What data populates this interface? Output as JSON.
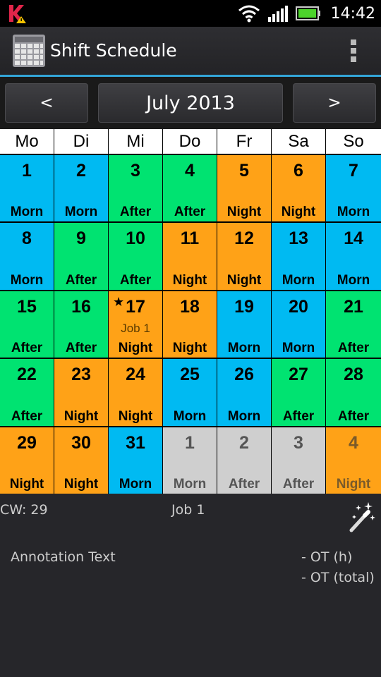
{
  "status_bar": {
    "time": "14:42",
    "left_icon": "k-notification-icon",
    "icons": [
      "wifi-icon",
      "signal-icon",
      "battery-icon"
    ]
  },
  "app": {
    "title": "Shift Schedule"
  },
  "nav": {
    "prev_label": "<",
    "month_label": "July 2013",
    "next_label": ">"
  },
  "weekdays": [
    "Mo",
    "Di",
    "Mi",
    "Do",
    "Fr",
    "Sa",
    "So"
  ],
  "colors": {
    "Morn": "#00baf2",
    "After": "#00e371",
    "Night": "#ffa217",
    "other_month": "#cfcfcf",
    "accent": "#33a6d8"
  },
  "calendar": [
    {
      "day": "1",
      "shift": "Morn"
    },
    {
      "day": "2",
      "shift": "Morn"
    },
    {
      "day": "3",
      "shift": "After"
    },
    {
      "day": "4",
      "shift": "After"
    },
    {
      "day": "5",
      "shift": "Night"
    },
    {
      "day": "6",
      "shift": "Night"
    },
    {
      "day": "7",
      "shift": "Morn"
    },
    {
      "day": "8",
      "shift": "Morn"
    },
    {
      "day": "9",
      "shift": "After"
    },
    {
      "day": "10",
      "shift": "After"
    },
    {
      "day": "11",
      "shift": "Night"
    },
    {
      "day": "12",
      "shift": "Night"
    },
    {
      "day": "13",
      "shift": "Morn"
    },
    {
      "day": "14",
      "shift": "Morn"
    },
    {
      "day": "15",
      "shift": "After"
    },
    {
      "day": "16",
      "shift": "After"
    },
    {
      "day": "17",
      "shift": "Night",
      "job": "Job 1",
      "star": true
    },
    {
      "day": "18",
      "shift": "Night"
    },
    {
      "day": "19",
      "shift": "Morn"
    },
    {
      "day": "20",
      "shift": "Morn"
    },
    {
      "day": "21",
      "shift": "After"
    },
    {
      "day": "22",
      "shift": "After"
    },
    {
      "day": "23",
      "shift": "Night"
    },
    {
      "day": "24",
      "shift": "Night"
    },
    {
      "day": "25",
      "shift": "Morn"
    },
    {
      "day": "26",
      "shift": "Morn"
    },
    {
      "day": "27",
      "shift": "After"
    },
    {
      "day": "28",
      "shift": "After"
    },
    {
      "day": "29",
      "shift": "Night"
    },
    {
      "day": "30",
      "shift": "Night"
    },
    {
      "day": "31",
      "shift": "Morn"
    },
    {
      "day": "1",
      "shift": "Morn",
      "other_month": true
    },
    {
      "day": "2",
      "shift": "After",
      "other_month": true
    },
    {
      "day": "3",
      "shift": "After",
      "other_month": true
    },
    {
      "day": "4",
      "shift": "Night",
      "other_month": true
    }
  ],
  "info": {
    "cw": "CW: 29",
    "job": "Job 1",
    "annotation": "Annotation Text",
    "ot_hours": "-   OT (h)",
    "ot_total": "-   OT (total)"
  }
}
